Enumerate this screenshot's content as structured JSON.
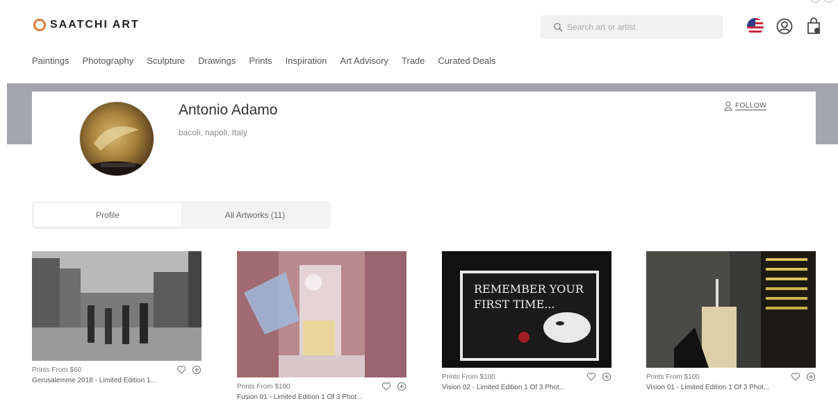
{
  "brand": {
    "name": "SAATCHI ART",
    "accent_color": "#e07b3a"
  },
  "search": {
    "placeholder": "Search art or artist"
  },
  "header_icons": [
    "flag-us-icon",
    "account-icon",
    "cart-icon"
  ],
  "nav": {
    "items": [
      {
        "label": "Paintings"
      },
      {
        "label": "Photography"
      },
      {
        "label": "Sculpture"
      },
      {
        "label": "Drawings"
      },
      {
        "label": "Prints"
      },
      {
        "label": "Inspiration"
      },
      {
        "label": "Art Advisory"
      },
      {
        "label": "Trade"
      },
      {
        "label": "Curated Deals"
      }
    ]
  },
  "profile": {
    "name": "Antonio Adamo",
    "location": "bacoli, napoli, Italy",
    "follow_label": "FOLLOW",
    "banner_color": "#a4a5b0"
  },
  "tabs": [
    {
      "label": "Profile",
      "active": true
    },
    {
      "label": "All Artworks (11)",
      "active": false
    }
  ],
  "artworks": [
    {
      "price": "Prints From $60",
      "title": "Gerusalemme 2018 - Limited Edition 1..."
    },
    {
      "price": "Prints From $100",
      "title": "Fusion 01 - Limited Edition 1 Of 3 Phot..."
    },
    {
      "price": "Prints From $100",
      "title": "Vision 02 - Limited Edition 1 Of 3 Phot...",
      "image_text": [
        "REMEMBER YOUR",
        "FIRST TIME..."
      ]
    },
    {
      "price": "Prints From $100",
      "title": "Vision 01 - Limited Edition 1 Of 3 Phot..."
    }
  ]
}
